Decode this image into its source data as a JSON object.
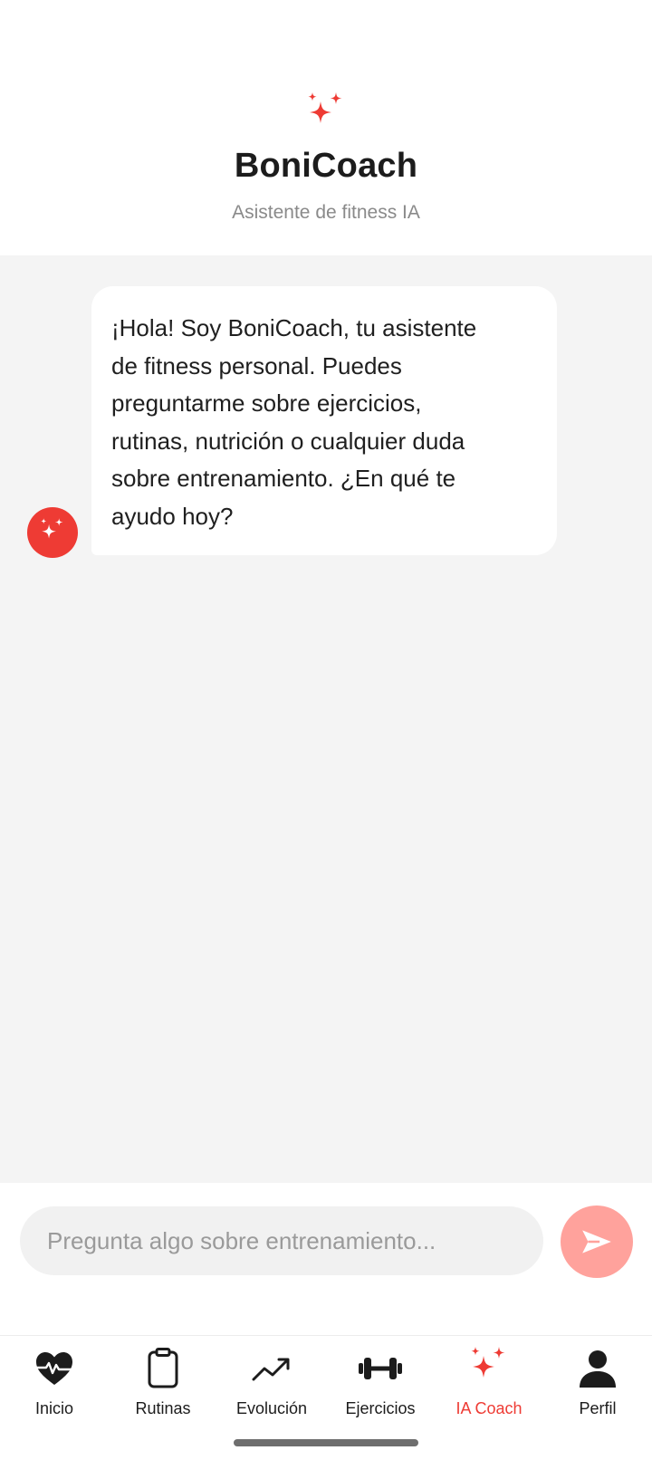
{
  "header": {
    "logo_icon": "sparkles-icon",
    "title": "BoniCoach",
    "subtitle": "Asistente de fitness IA"
  },
  "chat": {
    "messages": [
      {
        "sender": "assistant",
        "avatar_icon": "sparkles-icon",
        "lines": [
          "¡Hola! Soy BoniCoach, tu asistente",
          "de fitness personal. Puedes",
          "preguntarme sobre ejercicios,",
          "rutinas, nutrición o cualquier duda",
          "sobre entrenamiento. ¿En qué te",
          "ayudo hoy?"
        ]
      }
    ]
  },
  "composer": {
    "placeholder": "Pregunta algo sobre entrenamiento...",
    "value": "",
    "send_icon": "send-icon"
  },
  "nav": {
    "items": [
      {
        "label": "Inicio",
        "icon": "heart-pulse-icon",
        "active": false
      },
      {
        "label": "Rutinas",
        "icon": "clipboard-icon",
        "active": false
      },
      {
        "label": "Evolución",
        "icon": "trending-up-icon",
        "active": false
      },
      {
        "label": "Ejercicios",
        "icon": "dumbbell-icon",
        "active": false
      },
      {
        "label": "IA Coach",
        "icon": "sparkles-icon",
        "active": true
      },
      {
        "label": "Perfil",
        "icon": "user-icon",
        "active": false
      }
    ]
  },
  "colors": {
    "accent": "#ee3b34",
    "send_button": "#ffa29c",
    "background": "#f4f4f4",
    "text": "#1c1c1c",
    "muted": "#8a8a8a"
  }
}
